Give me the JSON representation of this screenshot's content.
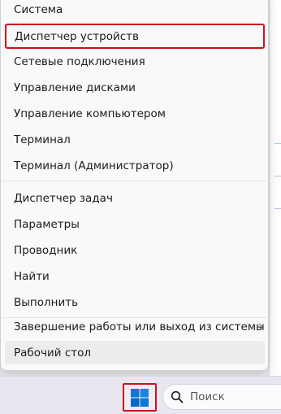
{
  "menu": {
    "items": [
      {
        "label": "Система"
      },
      {
        "label": "Диспетчер устройств"
      },
      {
        "label": "Сетевые подключения"
      },
      {
        "label": "Управление дисками"
      },
      {
        "label": "Управление компьютером"
      },
      {
        "label": "Терминал"
      },
      {
        "label": "Терминал (Администратор)"
      },
      {
        "label": "Диспетчер задач"
      },
      {
        "label": "Параметры"
      },
      {
        "label": "Проводник"
      },
      {
        "label": "Найти"
      },
      {
        "label": "Выполнить"
      },
      {
        "label": "Завершение работы или выход из системы"
      },
      {
        "label": "Рабочий стол"
      }
    ]
  },
  "taskbar": {
    "search_placeholder": "Поиск"
  },
  "colors": {
    "highlight_border": "#d0101b",
    "windows_logo": "#0a78d4",
    "menu_background": "#f9f9f9",
    "taskbar_background": "#eae6ef"
  },
  "icons": {
    "start": "windows-logo-icon",
    "search": "search-icon",
    "submenu": "chevron-right-icon"
  }
}
